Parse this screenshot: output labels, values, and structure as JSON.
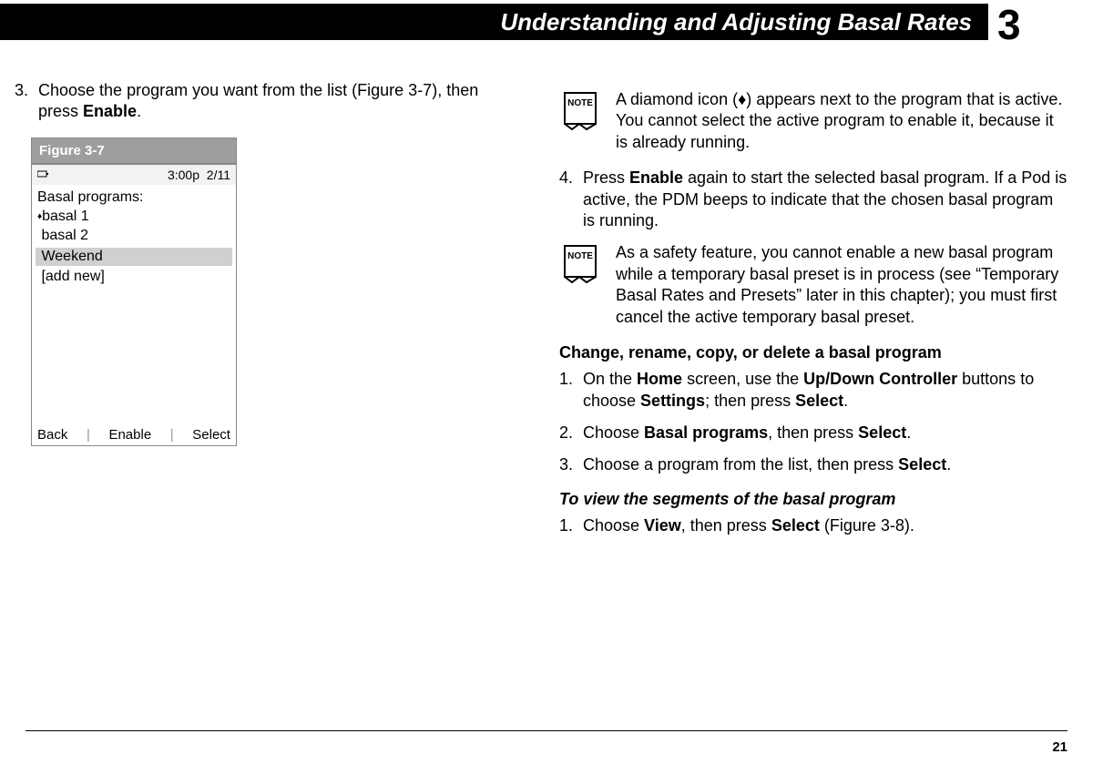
{
  "header": {
    "chapter_title": "Understanding and Adjusting Basal Rates",
    "chapter_number": "3"
  },
  "left": {
    "step3_num": "3.",
    "step3_text_a": "Choose the program you want from the list (Figure 3-7), then press ",
    "step3_bold": "Enable",
    "step3_text_b": ".",
    "figure_label": "Figure 3-7",
    "device": {
      "time": "3:00p",
      "date": "2/11",
      "title": "Basal programs:",
      "item1_diamond": "♦",
      "item1": "basal 1",
      "item2": "basal 2",
      "item3_selected": "Weekend",
      "item4": "[add new]",
      "soft_left": "Back",
      "soft_mid": "Enable",
      "soft_right": "Select"
    }
  },
  "right": {
    "note1": "A diamond icon (♦) appears next to the program that is active. You cannot select the active program to enable it, because it is already running.",
    "step4_num": "4.",
    "step4_a": "Press ",
    "step4_b1": "Enable",
    "step4_c": " again to start the selected basal program. If a Pod is active, the PDM beeps to indicate that the chosen basal program is running.",
    "note2": "As a safety feature, you cannot enable a new basal program while a temporary basal preset is in process (see “Temporary Basal Rates and Presets” later in this chapter); you must first cancel the active temporary basal preset.",
    "subhead": "Change, rename, copy, or delete a basal program",
    "s1_num": "1.",
    "s1_a": "On the ",
    "s1_b1": "Home",
    "s1_c": " screen, use the ",
    "s1_b2": "Up/Down Controller",
    "s1_d": " buttons to choose ",
    "s1_b3": "Settings",
    "s1_e": "; then press ",
    "s1_b4": "Select",
    "s1_f": ".",
    "s2_num": "2.",
    "s2_a": "Choose ",
    "s2_b1": "Basal programs",
    "s2_c": ", then press ",
    "s2_b2": "Select",
    "s2_d": ".",
    "s3_num": "3.",
    "s3_a": "Choose a program from the list, then press ",
    "s3_b1": "Select",
    "s3_c": ".",
    "subhead2": "To view the segments of the basal program",
    "v1_num": "1.",
    "v1_a": "Choose ",
    "v1_b1": "View",
    "v1_c": ", then press ",
    "v1_b2": "Select",
    "v1_d": " (Figure 3-8)."
  },
  "page_number": "21"
}
